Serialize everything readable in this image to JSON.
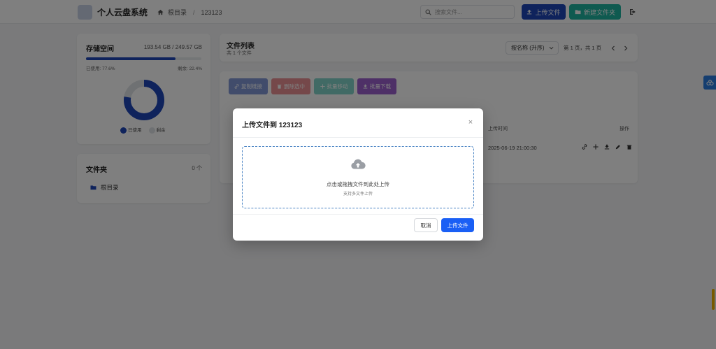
{
  "app": {
    "title": "个人云盘系统"
  },
  "breadcrumb": {
    "root": "根目录",
    "separator": "/",
    "current": "123123"
  },
  "search": {
    "placeholder": "搜索文件..."
  },
  "toolbar": {
    "upload_label": "上传文件",
    "new_folder_label": "新建文件夹"
  },
  "storage": {
    "title": "存储空间",
    "usage": "193.54 GB / 249.57 GB",
    "used_fraction": 0.776,
    "used_label": "已使用: 77.6%",
    "free_label": "剩余: 22.4%",
    "legend_used": "已使用",
    "legend_free": "剩余"
  },
  "folders": {
    "title": "文件夹",
    "count": "0 个",
    "items": [
      {
        "label": "根目录"
      }
    ]
  },
  "file_list": {
    "title": "文件列表",
    "subtitle": "共 1 个文件",
    "sort_value": "按名称 (升序)",
    "page_info": "第 1 页，共 1 页",
    "bulk": {
      "copy_link": "复制链接",
      "delete": "删除选中",
      "move": "批量移动",
      "download": "批量下载"
    },
    "columns": {
      "time": "上传时间",
      "ops": "操作"
    },
    "rows": [
      {
        "time": "2025-06-19 21:00:30"
      }
    ]
  },
  "modal": {
    "title": "上传文件到 123123",
    "close": "×",
    "drop_main": "点击或拖拽文件到此处上传",
    "drop_sub": "支持多文件上传",
    "cancel": "取消",
    "confirm": "上传文件"
  },
  "colors": {
    "primary": "#1f47b8",
    "accent": "#1a5ff5",
    "teal": "#1fb4a0",
    "danger": "#d9363e",
    "purple": "#7b2bbf"
  }
}
